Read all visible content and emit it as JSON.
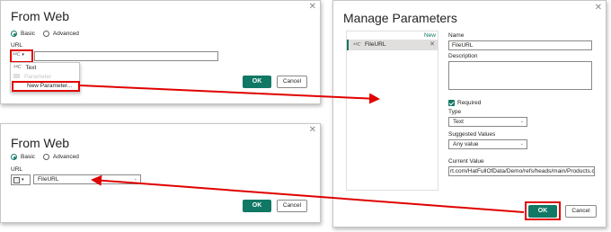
{
  "dialog_top": {
    "title": "From Web",
    "radio_basic": "Basic",
    "radio_advanced": "Advanced",
    "url_label": "URL",
    "url_type_icon": "abc-icon",
    "menu_items": [
      "Text",
      "Parameter",
      "New Parameter..."
    ],
    "ok_label": "OK",
    "cancel_label": "Cancel"
  },
  "dialog_bottom": {
    "title": "From Web",
    "radio_basic": "Basic",
    "radio_advanced": "Advanced",
    "url_label": "URL",
    "parameter_value": "FileURL",
    "ok_label": "OK",
    "cancel_label": "Cancel"
  },
  "manage_parameters": {
    "title": "Manage Parameters",
    "new_link": "New",
    "list_item": "FileURL",
    "name_label": "Name",
    "name_value": "FileURL",
    "description_label": "Description",
    "required_label": "Required",
    "type_label": "Type",
    "type_value": "Text",
    "suggested_label": "Suggested Values",
    "suggested_value": "Any value",
    "current_label": "Current Value",
    "current_value": "rt.com/HatFullOfData/Demo/refs/heads/main/Products.csv",
    "ok_label": "OK",
    "cancel_label": "Cancel"
  },
  "colors": {
    "accent": "#117865",
    "highlight": "#e00000"
  }
}
